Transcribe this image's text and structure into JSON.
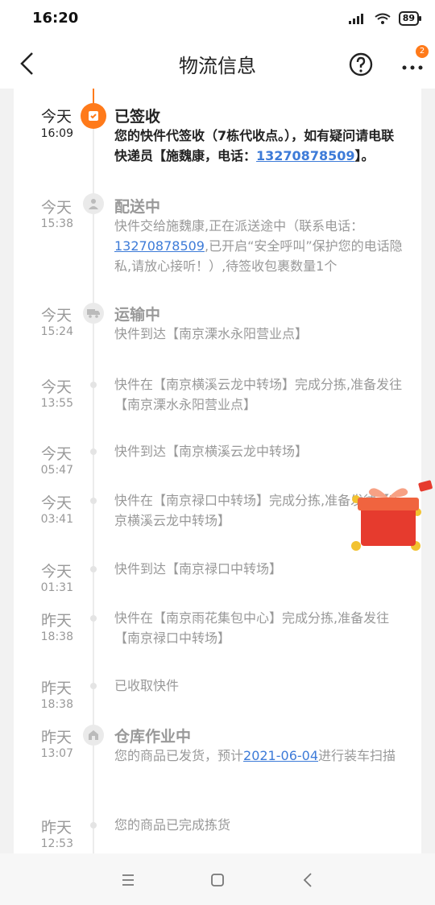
{
  "status_bar": {
    "time": "16:20",
    "battery": "89"
  },
  "header": {
    "title": "物流信息",
    "badge": "2"
  },
  "events": [
    {
      "day": "今天",
      "time": "16:09",
      "title": "已签收",
      "desc_parts": [
        "您的快件代签收（7栋代收点。），如有疑问请电联快递员【施魏康，电话：",
        "13270878509",
        "】。"
      ],
      "icon": "sign-icon"
    },
    {
      "day": "今天",
      "time": "15:38",
      "title": "配送中",
      "desc_parts": [
        "快件交给施魏康,正在派送途中（联系电话：",
        "13270878509",
        ",已开启“安全呼叫”保护您的电话隐私,请放心接听！）,待签收包裹数量1个"
      ],
      "icon": "courier-icon"
    },
    {
      "day": "今天",
      "time": "15:24",
      "title": "运输中",
      "desc": "快件到达【南京溧水永阳营业点】",
      "icon": "truck-icon"
    },
    {
      "day": "今天",
      "time": "13:55",
      "desc": "快件在【南京横溪云龙中转场】完成分拣,准备发往【南京溧水永阳营业点】"
    },
    {
      "day": "今天",
      "time": "05:47",
      "desc": "快件到达【南京横溪云龙中转场】"
    },
    {
      "day": "今天",
      "time": "03:41",
      "desc": "快件在【南京禄口中转场】完成分拣,准备发往【南京横溪云龙中转场】"
    },
    {
      "day": "今天",
      "time": "01:31",
      "desc": "快件到达【南京禄口中转场】"
    },
    {
      "day": "昨天",
      "time": "18:38",
      "desc": "快件在【南京雨花集包中心】完成分拣,准备发往【南京禄口中转场】"
    },
    {
      "day": "昨天",
      "time": "18:38",
      "desc": "已收取快件"
    },
    {
      "day": "昨天",
      "time": "13:07",
      "title": "仓库作业中",
      "desc_parts": [
        "您的商品已发货，预计",
        "2021-06-04",
        "进行装车扫描"
      ],
      "icon": "warehouse-icon"
    },
    {
      "day": "昨天",
      "time": "12:53",
      "desc": "您的商品已完成拣货"
    }
  ],
  "colors": {
    "accent": "#ff7a1a",
    "link": "#3d7bd8"
  }
}
